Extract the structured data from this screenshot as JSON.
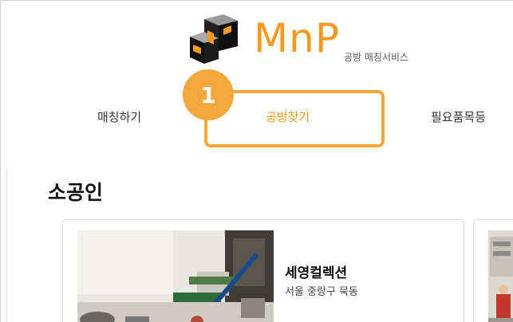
{
  "brand": {
    "name": "MnP",
    "subtitle": "공방 매칭서비스",
    "accent_color": "#f59a1e",
    "logo_icon": "mnp-cube-logo"
  },
  "nav": {
    "tabs": [
      {
        "label": "매칭하기"
      },
      {
        "label": "공방찾기"
      },
      {
        "label": "필요품목등"
      }
    ],
    "active_index": 1
  },
  "annotation": {
    "step_number": "1",
    "highlight_color": "#f2a83d"
  },
  "section": {
    "title": "소공인"
  },
  "cards": [
    {
      "name": "세영컬렉션",
      "address": "서울 중랑구 묵동"
    }
  ]
}
